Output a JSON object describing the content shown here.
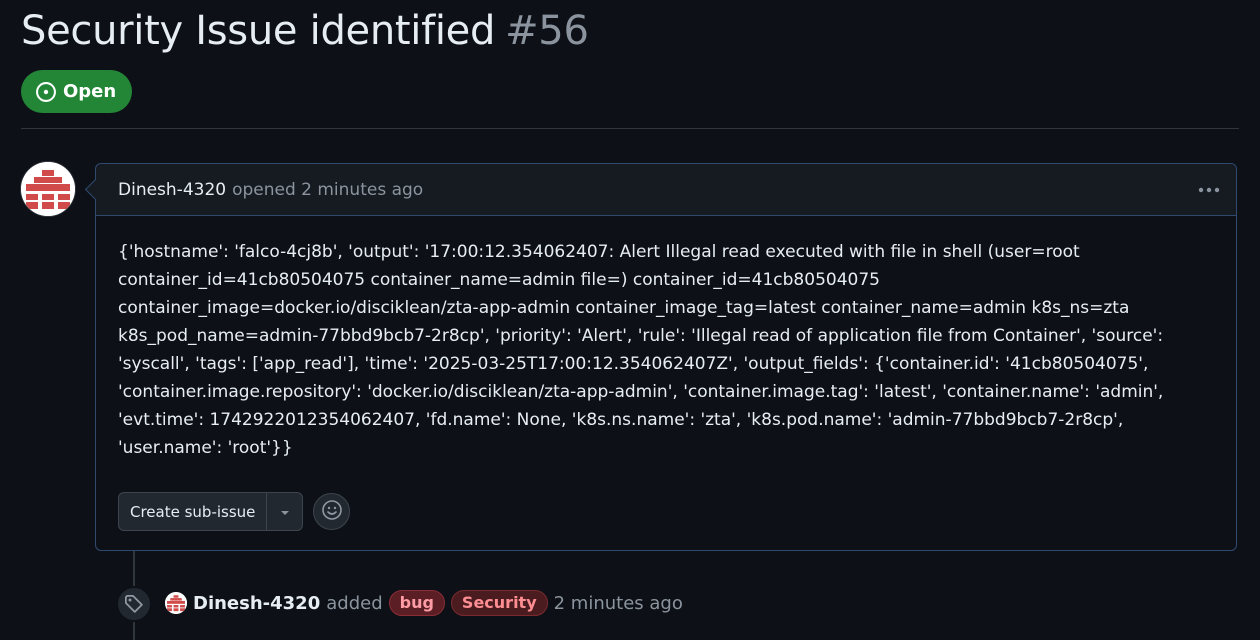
{
  "issue": {
    "title": "Security Issue identified",
    "number": "#56",
    "state": "Open"
  },
  "comment": {
    "author": "Dinesh-4320",
    "meta": "opened 2 minutes ago",
    "body": "{'hostname': 'falco-4cj8b', 'output': '17:00:12.354062407: Alert Illegal read executed with file in shell (user=root container_id=41cb80504075 container_name=admin file=) container_id=41cb80504075 container_image=docker.io/disciklean/zta-app-admin container_image_tag=latest container_name=admin k8s_ns=zta k8s_pod_name=admin-77bbd9bcb7-2r8cp', 'priority': 'Alert', 'rule': 'Illegal read of application file from Container', 'source': 'syscall', 'tags': ['app_read'], 'time': '2025-03-25T17:00:12.354062407Z', 'output_fields': {'container.id': '41cb80504075', 'container.image.repository': 'docker.io/disciklean/zta-app-admin', 'container.image.tag': 'latest', 'container.name': 'admin', 'evt.time': 1742922012354062407, 'fd.name': None, 'k8s.ns.name': 'zta', 'k8s.pod.name': 'admin-77bbd9bcb7-2r8cp', 'user.name': 'root'}}",
    "create_subissue_label": "Create sub-issue"
  },
  "event": {
    "author": "Dinesh-4320",
    "action": "added",
    "labels": [
      "bug",
      "Security"
    ],
    "time": "2 minutes ago"
  },
  "colors": {
    "open_green": "#238636",
    "background": "#0d1117",
    "muted_text": "#8b949e"
  }
}
